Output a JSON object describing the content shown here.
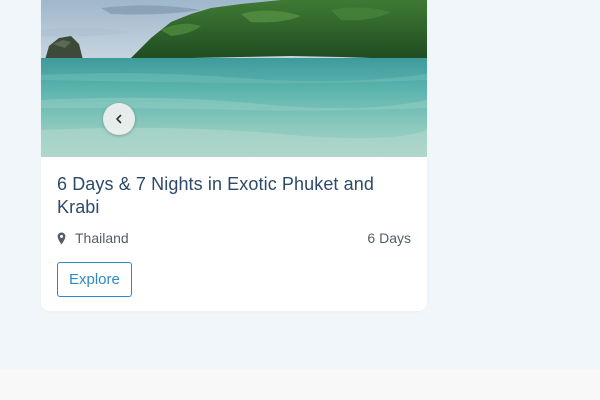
{
  "card": {
    "title": "6 Days & 7 Nights in Exotic Phuket and Krabi",
    "location": "Thailand",
    "duration": "6 Days",
    "explore_label": "Explore",
    "image_subject": "tropical beach with turquoise sea and green island",
    "icons": {
      "location": "map-pin-icon",
      "prev": "chevron-left-icon"
    }
  },
  "colors": {
    "title": "#2c4a6b",
    "accent": "#2f8ac4",
    "page_background": "#f0f6f9"
  }
}
